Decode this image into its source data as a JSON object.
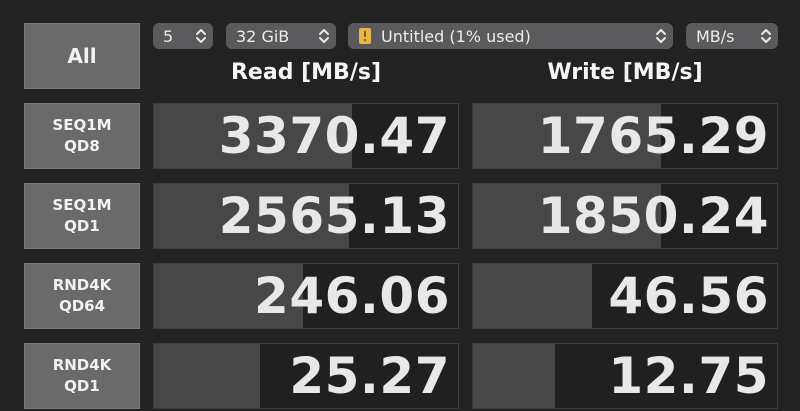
{
  "toolbar": {
    "all_label": "All",
    "runs": "5",
    "size": "32 GiB",
    "target": "Untitled (1% used)",
    "unit": "MB/s"
  },
  "headers": {
    "read": "Read [MB/s]",
    "write": "Write [MB/s]"
  },
  "tests": [
    {
      "line1": "SEQ1M",
      "line2": "QD8",
      "read": "3370.47",
      "write": "1765.29",
      "read_fill": 0.65,
      "write_fill": 0.62
    },
    {
      "line1": "SEQ1M",
      "line2": "QD1",
      "read": "2565.13",
      "write": "1850.24",
      "read_fill": 0.64,
      "write_fill": 0.62
    },
    {
      "line1": "RND4K",
      "line2": "QD64",
      "read": "246.06",
      "write": "46.56",
      "read_fill": 0.49,
      "write_fill": 0.39
    },
    {
      "line1": "RND4K",
      "line2": "QD1",
      "read": "25.27",
      "write": "12.75",
      "read_fill": 0.35,
      "write_fill": 0.27
    }
  ],
  "colors": {
    "background": "#222223",
    "button": "#6a6a6a",
    "select": "#5a5a5c",
    "cell": "#202021",
    "bar": "#474748",
    "drive_icon": "#e7b54a"
  },
  "icons": {
    "drive": "external-drive-icon",
    "chevron": "chevron-up-down-icon"
  }
}
